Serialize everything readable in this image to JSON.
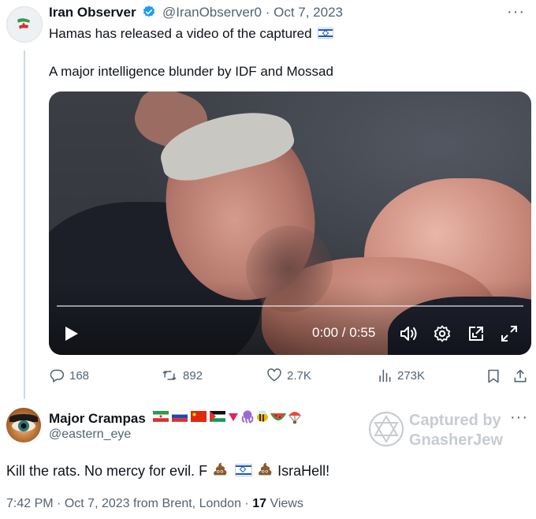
{
  "tweet": {
    "author_name": "Iran Observer",
    "author_handle": "@IranObserver0",
    "separator": "·",
    "date": "Oct 7, 2023",
    "more": "···",
    "text_line1": "Hamas has released a video of the captured",
    "text_line2": "A major intelligence blunder by IDF and Mossad",
    "video": {
      "time": "0:00 / 0:55",
      "progress": 0
    },
    "actions": {
      "replies": "168",
      "retweets": "892",
      "likes": "2.7K",
      "views": "273K"
    }
  },
  "reply": {
    "author_name": "Major Crampas",
    "author_handle": "@eastern_eye",
    "more": "···",
    "text_part1": "Kill the rats. No mercy for evil. F",
    "text_part2": "IsraHell!",
    "time": "7:42 PM",
    "date": "Oct 7, 2023 from Brent, London",
    "views_count": "17",
    "views_label": "Views"
  },
  "watermark": {
    "line1": "Captured by",
    "line2": "GnasherJew"
  },
  "colors": {
    "text": "#0f1419",
    "secondary": "#536471",
    "verified": "#1d9bf0",
    "thread_line": "#cfd9de"
  }
}
